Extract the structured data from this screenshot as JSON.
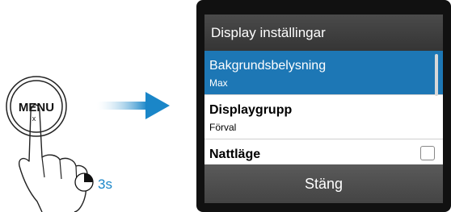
{
  "illustration": {
    "button_label": "MENU",
    "button_sublabel": "x",
    "hold_duration": "3s"
  },
  "dialog": {
    "title": "Display inställingar",
    "items": [
      {
        "label": "Bakgrundsbelysning",
        "value": "Max",
        "selected": true
      },
      {
        "label": "Displaygrupp",
        "value": "Förval",
        "selected": false
      },
      {
        "label": "Nattläge",
        "value": "",
        "selected": false
      }
    ],
    "close_label": "Stäng"
  },
  "colors": {
    "accent": "#1d77b5",
    "arrow": "#1a86c8"
  }
}
